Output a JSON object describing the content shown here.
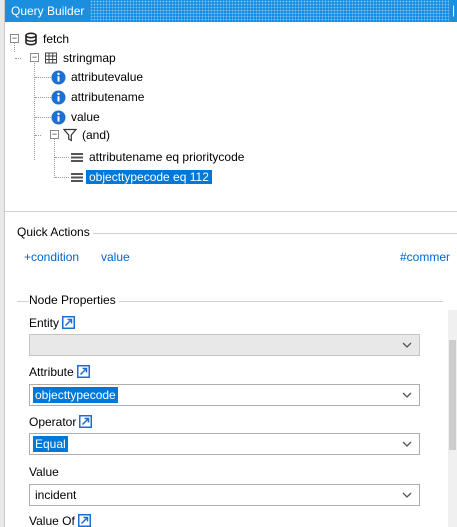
{
  "panel": {
    "title": "Query Builder",
    "pin_glyph": "❘"
  },
  "tree": {
    "nodes": [
      {
        "id": "fetch",
        "label": "fetch",
        "icon": "database-icon",
        "toggle": "−"
      },
      {
        "id": "stringmap",
        "label": "stringmap",
        "icon": "table-icon",
        "toggle": "−"
      },
      {
        "id": "attributevalue",
        "label": "attributevalue",
        "icon": "attribute-info-icon"
      },
      {
        "id": "attributename",
        "label": "attributename",
        "icon": "attribute-info-icon"
      },
      {
        "id": "value",
        "label": "value",
        "icon": "attribute-info-icon"
      },
      {
        "id": "and",
        "label": "(and)",
        "icon": "filter-icon",
        "toggle": "−"
      },
      {
        "id": "cond1",
        "label": "attributename eq prioritycode",
        "icon": "condition-icon"
      },
      {
        "id": "cond2",
        "label": "objecttypecode eq 112",
        "icon": "condition-icon",
        "selected": true
      }
    ]
  },
  "quick_actions": {
    "header": "Quick Actions",
    "links": [
      "+condition",
      "value",
      "#commer"
    ]
  },
  "node_properties": {
    "header": "Node Properties",
    "entity": {
      "label": "Entity",
      "value": ""
    },
    "attribute": {
      "label": "Attribute",
      "value": "objecttypecode"
    },
    "operator": {
      "label": "Operator",
      "value": "Equal"
    },
    "value": {
      "label": "Value",
      "value": "incident"
    },
    "value_of": {
      "label": "Value Of"
    }
  },
  "colors": {
    "accent": "#0078d7",
    "titlebar": "#1a8fe0",
    "link": "#0066cc"
  }
}
